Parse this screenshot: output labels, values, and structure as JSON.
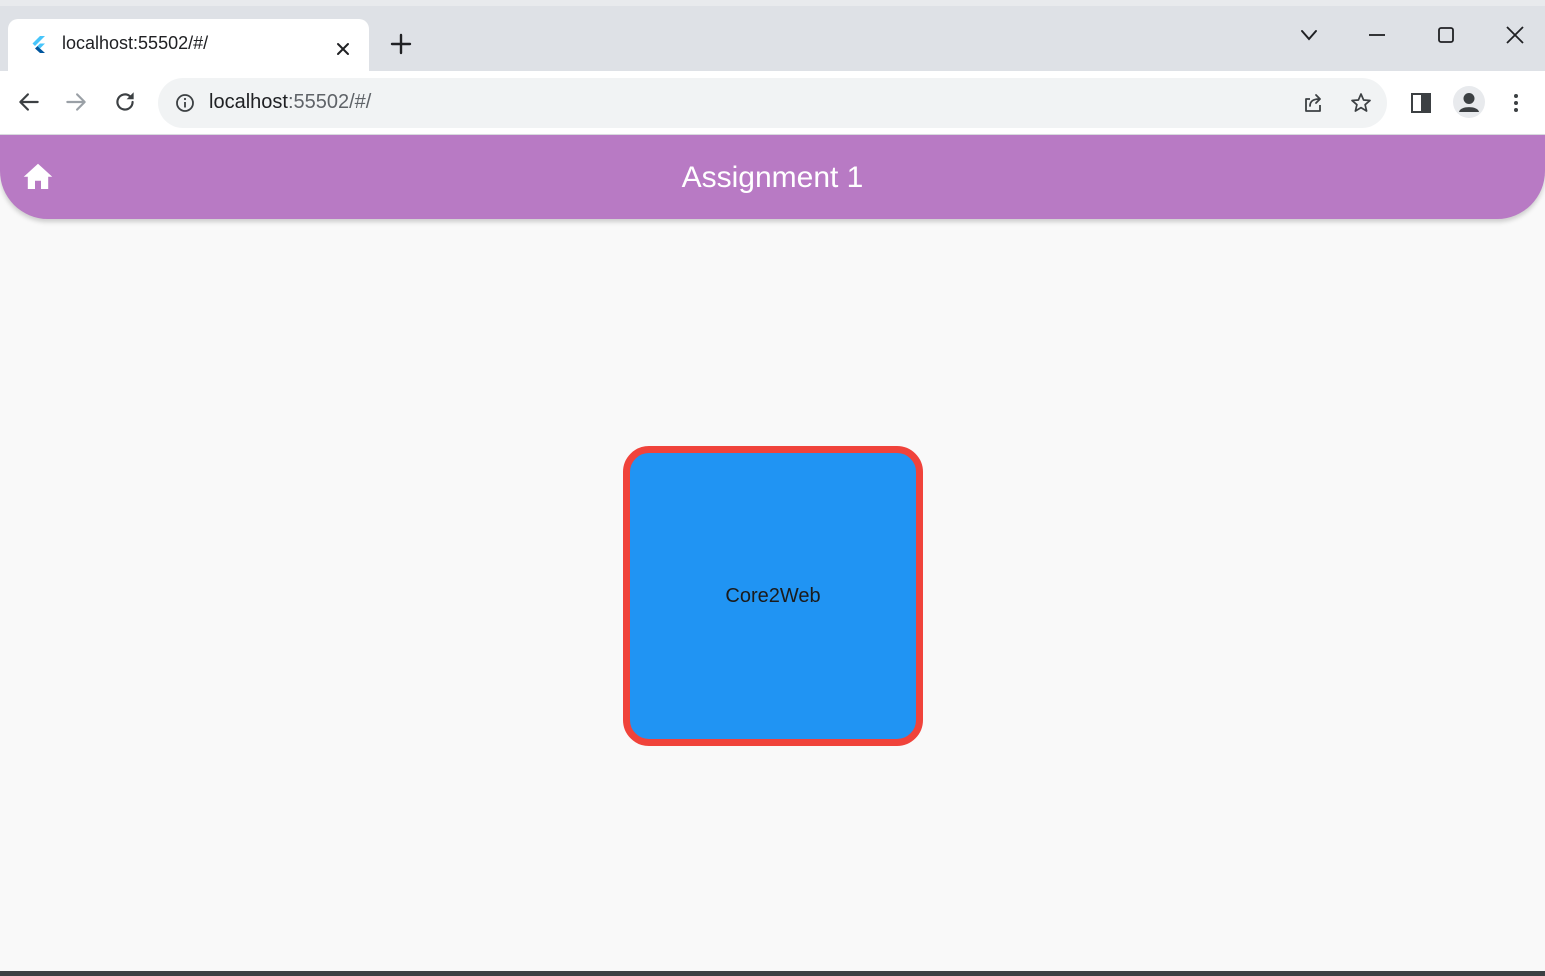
{
  "browser": {
    "tab": {
      "title": "localhost:55502/#/",
      "favicon": "flutter-icon"
    },
    "address_bar": {
      "host": "localhost",
      "rest": ":55502/#/"
    },
    "window_controls": [
      "chevron-down-icon",
      "minimize-icon",
      "maximize-icon",
      "close-icon"
    ],
    "toolbar_icons": [
      "back-icon",
      "forward-icon",
      "reload-icon",
      "share-icon",
      "bookmark-star-icon",
      "side-panel-icon",
      "profile-icon",
      "menu-kebab-icon"
    ]
  },
  "appbar": {
    "title": "Assignment 1",
    "leading_icon": "home-icon",
    "color": "#b87ac4"
  },
  "body": {
    "card": {
      "label": "Core2Web",
      "fill_color": "#2094f3",
      "border_color": "#f0433b"
    },
    "background_color": "#f9f9f9"
  }
}
